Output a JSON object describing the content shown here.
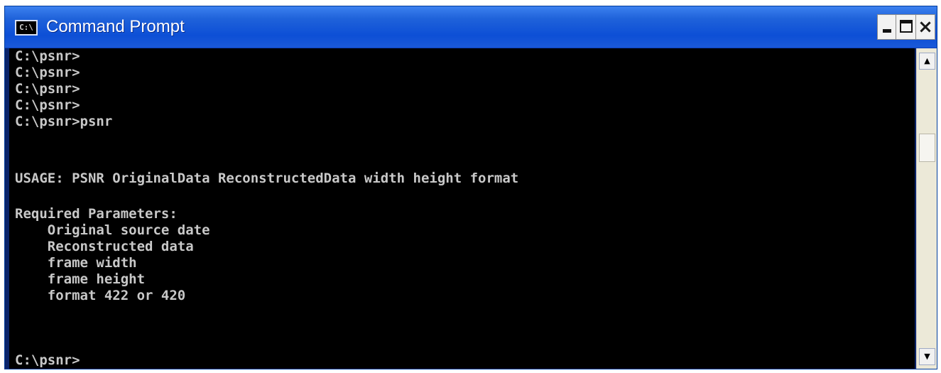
{
  "window": {
    "title": "Command Prompt",
    "icon_name": "command-prompt-icon",
    "icon_glyph": "C:\\",
    "controls": {
      "minimize_icon": "minimize-icon",
      "maximize_icon": "maximize-icon",
      "close_icon": "close-icon",
      "close_glyph": "×"
    }
  },
  "console": {
    "lines": [
      "C:\\psnr>",
      "C:\\psnr>",
      "C:\\psnr>",
      "C:\\psnr>",
      "C:\\psnr>psnr",
      "",
      "",
      "USAGE: PSNR OriginalData ReconstructedData width height format",
      "",
      "Required Parameters:",
      "    Original source date",
      "    Reconstructed data",
      "    frame width",
      "    frame height",
      "    format 422 or 420",
      "",
      "",
      "",
      "",
      "C:\\psnr>"
    ]
  },
  "scrollbar": {
    "up_glyph": "▲",
    "down_glyph": "▼"
  },
  "colors": {
    "titlebar": "#0d4fd6",
    "console_bg": "#000000",
    "console_text": "#c8c8c8"
  }
}
